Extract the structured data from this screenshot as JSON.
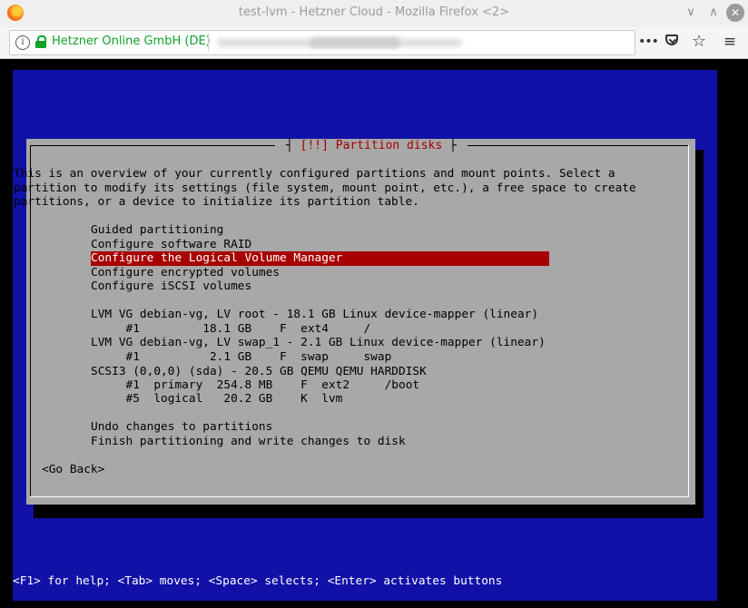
{
  "browser": {
    "window_title": "test-lvm - Hetzner Cloud - Mozilla Firefox <2>",
    "identity": "Hetzner Online GmbH (DE)",
    "controls": {
      "minimize": "∨",
      "maximize": "∧",
      "close": "✕"
    },
    "toolbar": {
      "more": "•••",
      "bookmark": "☆",
      "menu": "≡"
    },
    "info_glyph": "i"
  },
  "installer": {
    "dialog_title": "[!!] Partition disks",
    "intro_lines": [
      "This is an overview of your currently configured partitions and mount points. Select a",
      "partition to modify its settings (file system, mount point, etc.), a free space to create",
      "partitions, or a device to initialize its partition table."
    ],
    "items": [
      {
        "text": "Guided partitioning",
        "selected": false
      },
      {
        "text": "Configure software RAID",
        "selected": false
      },
      {
        "text": "Configure the Logical Volume Manager",
        "selected": true
      },
      {
        "text": "Configure encrypted volumes",
        "selected": false
      },
      {
        "text": "Configure iSCSI volumes",
        "selected": false
      },
      {
        "text": "",
        "selected": false
      },
      {
        "text": "LVM VG debian-vg, LV root - 18.1 GB Linux device-mapper (linear)",
        "selected": false
      },
      {
        "text": "     #1         18.1 GB    F  ext4     /",
        "selected": false
      },
      {
        "text": "LVM VG debian-vg, LV swap_1 - 2.1 GB Linux device-mapper (linear)",
        "selected": false
      },
      {
        "text": "     #1          2.1 GB    F  swap     swap",
        "selected": false
      },
      {
        "text": "SCSI3 (0,0,0) (sda) - 20.5 GB QEMU QEMU HARDDISK",
        "selected": false
      },
      {
        "text": "     #1  primary  254.8 MB    F  ext2     /boot",
        "selected": false
      },
      {
        "text": "     #5  logical   20.2 GB    K  lvm",
        "selected": false
      },
      {
        "text": "",
        "selected": false
      },
      {
        "text": "Undo changes to partitions",
        "selected": false
      },
      {
        "text": "Finish partitioning and write changes to disk",
        "selected": false
      }
    ],
    "go_back": "<Go Back>",
    "help_line": "<F1> for help; <Tab> moves; <Space> selects; <Enter> activates buttons"
  }
}
